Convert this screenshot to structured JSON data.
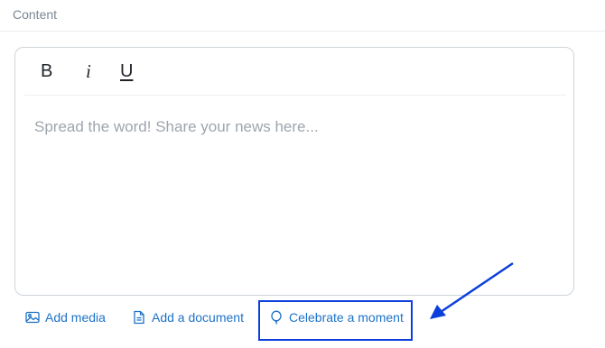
{
  "section": {
    "label": "Content"
  },
  "toolbar": {
    "bold_label": "B",
    "italic_label": "i",
    "underline_label": "U"
  },
  "editor": {
    "placeholder": "Spread the word! Share your news here..."
  },
  "actions": {
    "add_media": "Add media",
    "add_document": "Add a document",
    "celebrate": "Celebrate a moment"
  },
  "colors": {
    "link": "#1d72c8",
    "annotation": "#0b3fdc",
    "placeholder": "#9ea5ad"
  },
  "icons": {
    "media": "image-icon",
    "document": "document-icon",
    "celebrate": "balloon-icon"
  }
}
